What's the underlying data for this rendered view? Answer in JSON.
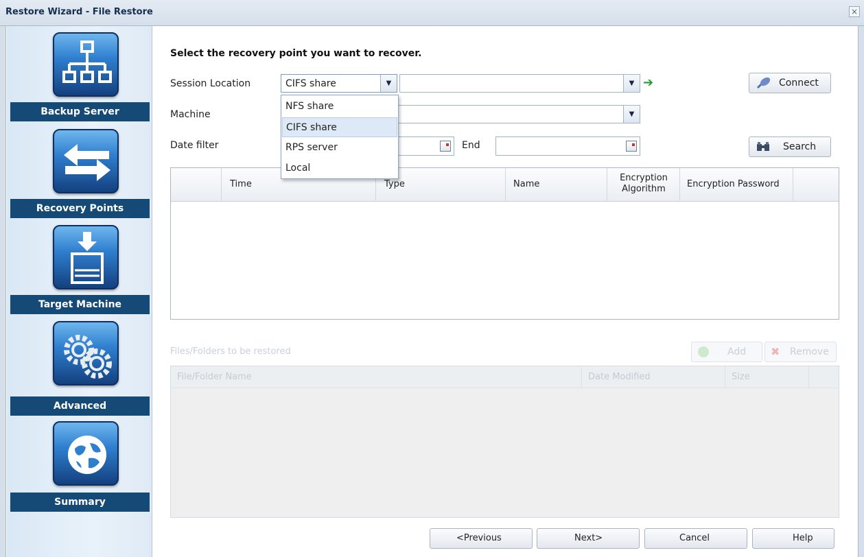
{
  "window": {
    "title": "Restore Wizard - File Restore",
    "close_symbol": "×"
  },
  "sidebar": {
    "steps": [
      {
        "label": "Backup Server",
        "icon": "network-tree-icon"
      },
      {
        "label": "Recovery Points",
        "icon": "exchange-arrows-icon"
      },
      {
        "label": "Target Machine",
        "icon": "drive-download-icon"
      },
      {
        "label": "Advanced",
        "icon": "gears-icon"
      },
      {
        "label": "Summary",
        "icon": "globe-icon"
      }
    ]
  },
  "main": {
    "heading": "Select the recovery point you want to recover.",
    "session_location": {
      "label": "Session Location",
      "selected": "CIFS share",
      "path_value": "",
      "options": [
        "NFS share",
        "CIFS share",
        "RPS server",
        "Local"
      ]
    },
    "machine": {
      "label": "Machine",
      "value": ""
    },
    "date_filter": {
      "label": "Date filter",
      "end_label": "End",
      "start_value": "",
      "end_value": ""
    },
    "buttons": {
      "connect": "Connect",
      "search": "Search"
    },
    "recovery_table": {
      "columns": [
        "",
        "Time",
        "Type",
        "Name",
        "Encryption Algorithm",
        "Encryption Password",
        ""
      ],
      "encryption_algorithm_lines": [
        "Encryption",
        "Algorithm"
      ],
      "rows": []
    },
    "files_section": {
      "title": "Files/Folders to be restored",
      "add_label": "Add",
      "remove_label": "Remove",
      "columns": [
        "File/Folder Name",
        "Date Modified",
        "Size",
        ""
      ],
      "rows": []
    }
  },
  "footer": {
    "previous": "<Previous",
    "next": "Next>",
    "cancel": "Cancel",
    "help": "Help"
  },
  "colors": {
    "sidebar_label_bg": "#154a76",
    "icon_blue": "#2f7fcf",
    "go_arrow": "#1e9e2e",
    "selected_option_bg": "#dde9f6"
  }
}
